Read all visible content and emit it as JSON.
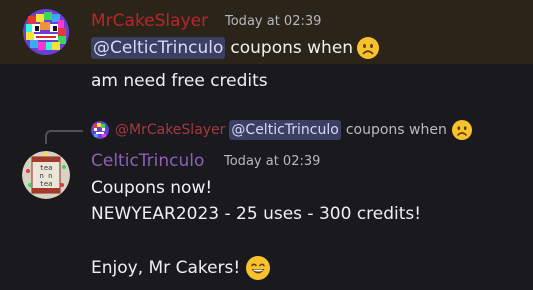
{
  "messages": [
    {
      "username": "MrCakeSlayer",
      "username_color": "#b8262b",
      "timestamp": "Today at 02:39",
      "mention": "@CelticTrinculo",
      "line1_text": "coupons when",
      "line1_emoji": "frowning-emoji",
      "line2_text": "am need free credits"
    },
    {
      "reply": {
        "username": "@MrCakeSlayer",
        "mention": "@CelticTrinculo",
        "text": "coupons when",
        "emoji": "frowning-emoji"
      },
      "username": "CelticTrinculo",
      "username_color": "#8e60b7",
      "timestamp": "Today at 02:39",
      "line1": "Coupons now!",
      "line2": "NEWYEAR2023 - 25 uses - 300 credits!",
      "line4_text": "Enjoy, Mr Cakers!",
      "line4_emoji": "grinning-emoji"
    }
  ],
  "colors": {
    "background": "#1a1a1e",
    "highlight_background": "#2b2519",
    "mention_background": "#3b3f63",
    "text": "#eef0f3"
  }
}
